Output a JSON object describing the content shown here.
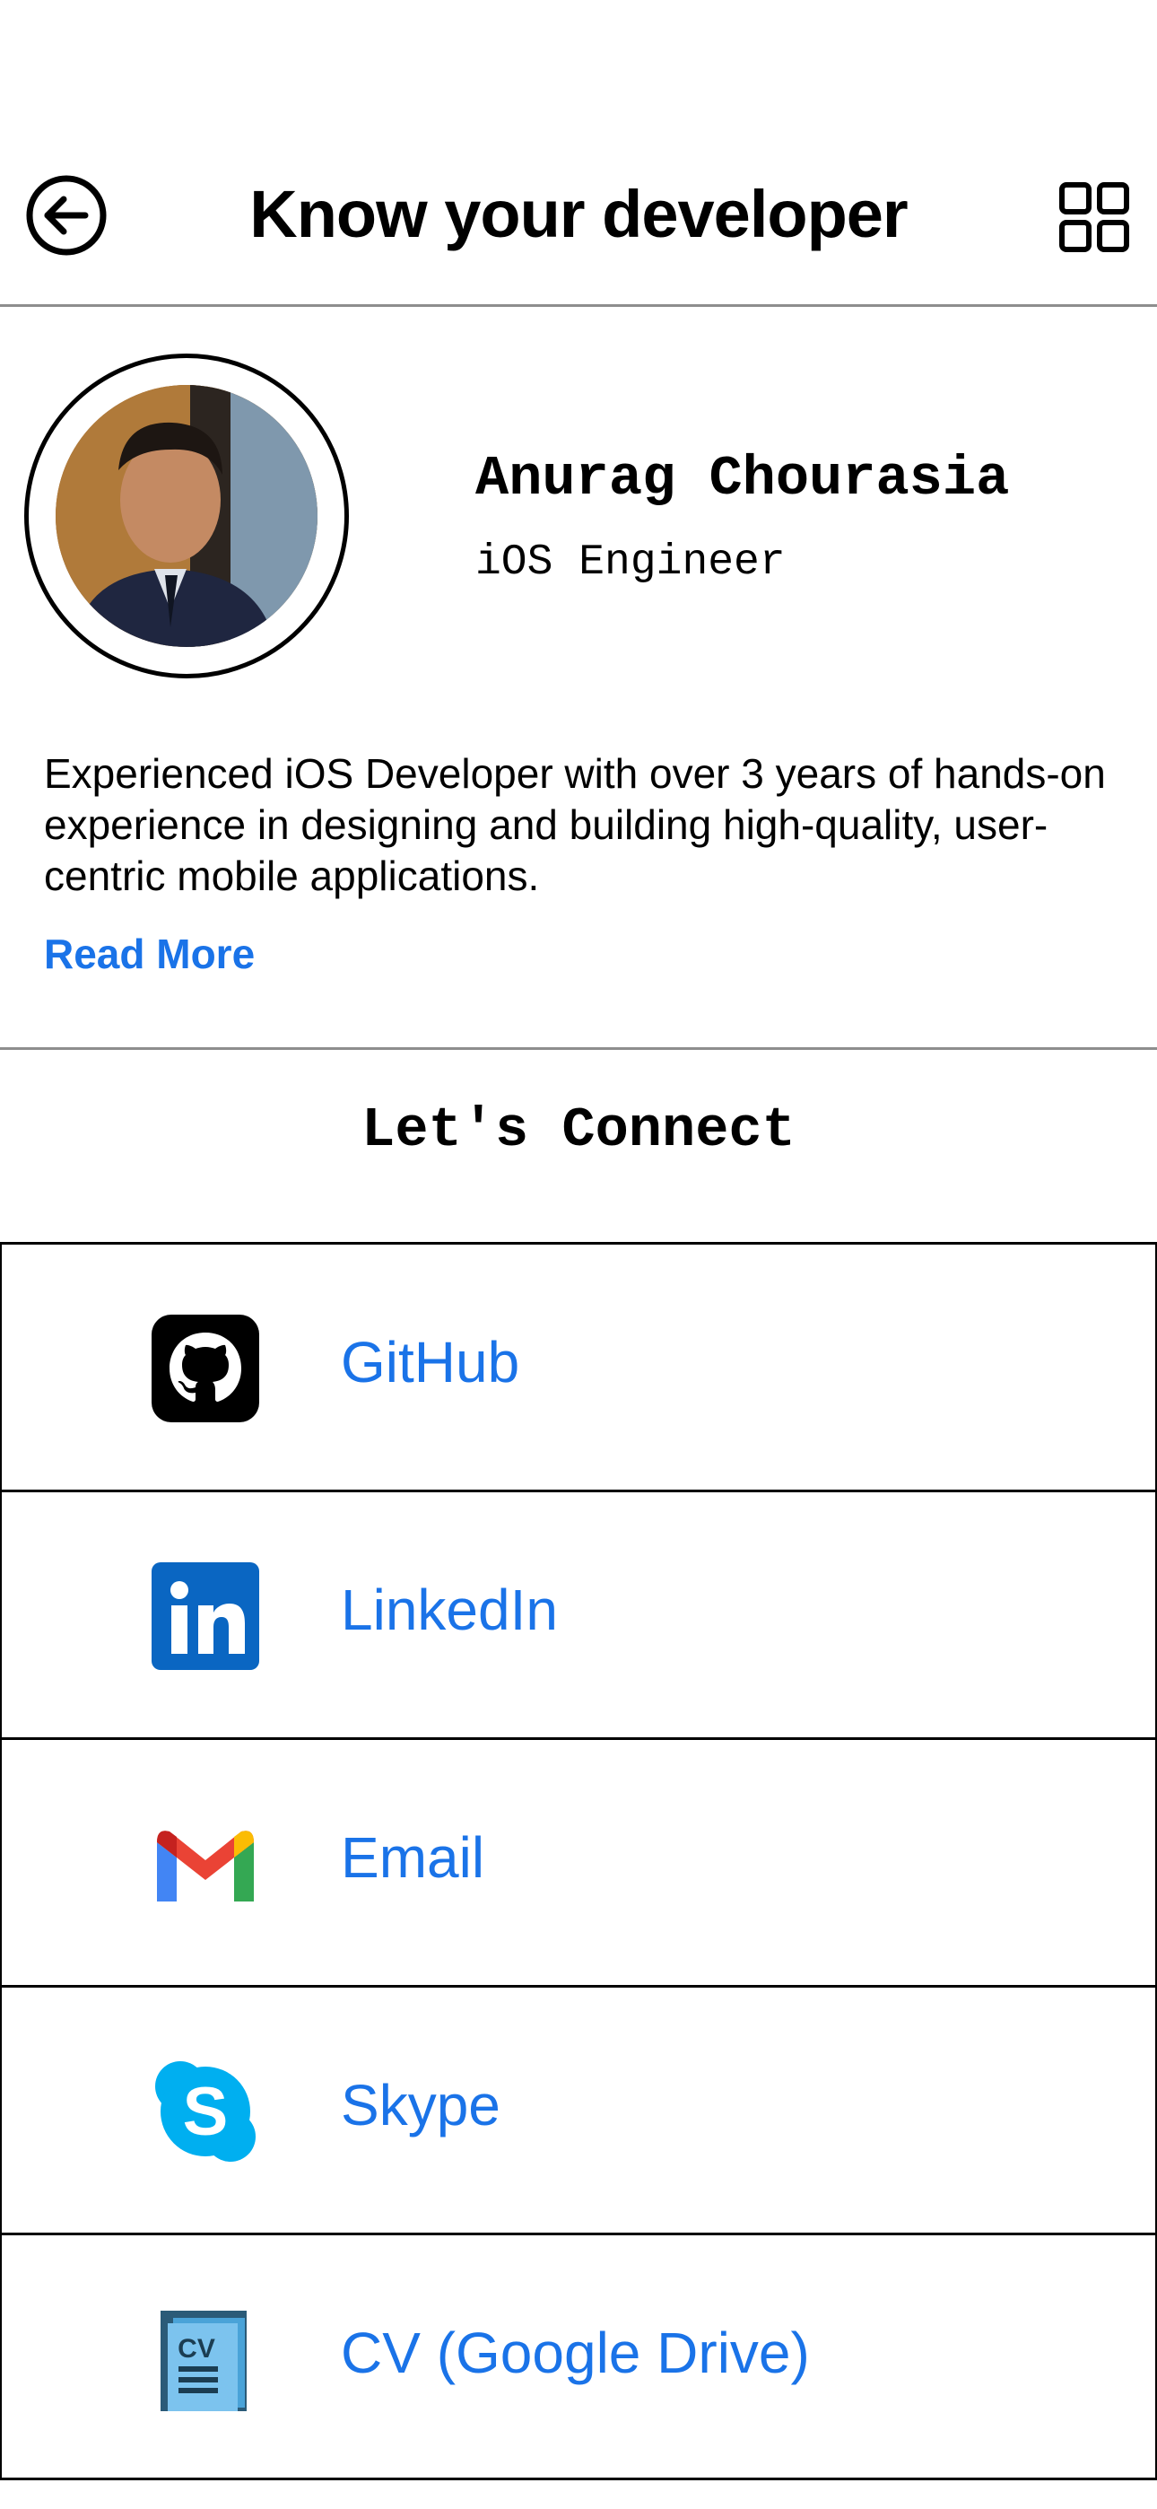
{
  "header": {
    "title": "Know your developer",
    "back_icon": "arrow-left-circle-icon",
    "menu_icon": "grid-icon"
  },
  "profile": {
    "name": "Anurag Chourasia",
    "role": "iOS Engineer",
    "bio": "Experienced iOS Developer with over 3 years of hands-on experience in designing and building high-quality, user-centric mobile applications.",
    "read_more": "Read More"
  },
  "connect": {
    "title": "Let's Connect",
    "links": [
      {
        "label": "GitHub",
        "icon": "github-icon"
      },
      {
        "label": "LinkedIn",
        "icon": "linkedin-icon"
      },
      {
        "label": "Email",
        "icon": "gmail-icon"
      },
      {
        "label": "Skype",
        "icon": "skype-icon"
      },
      {
        "label": "CV (Google Drive)",
        "icon": "cv-document-icon"
      }
    ]
  },
  "colors": {
    "accent": "#1a73e8",
    "divider": "#8e8e8e"
  }
}
